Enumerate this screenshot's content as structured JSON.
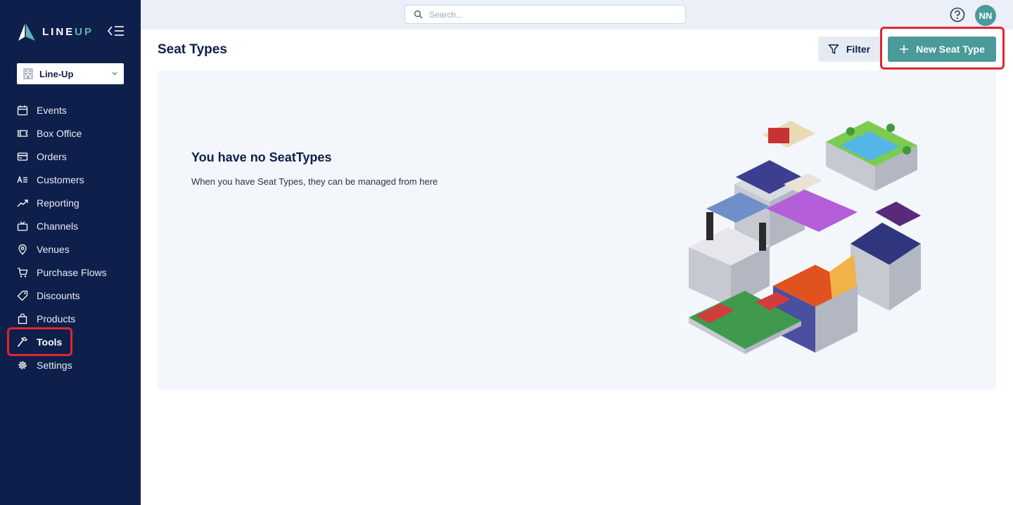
{
  "app": {
    "logo_text_main": "LINE",
    "logo_text_accent": "UP"
  },
  "sidebar": {
    "org_select": {
      "value": "Line-Up"
    },
    "items": [
      {
        "label": "Events",
        "icon": "calendar-icon",
        "active": false
      },
      {
        "label": "Box Office",
        "icon": "ticket-icon",
        "active": false
      },
      {
        "label": "Orders",
        "icon": "credit-card-icon",
        "active": false
      },
      {
        "label": "Customers",
        "icon": "contacts-icon",
        "active": false
      },
      {
        "label": "Reporting",
        "icon": "trend-chart-icon",
        "active": false
      },
      {
        "label": "Channels",
        "icon": "tv-icon",
        "active": false
      },
      {
        "label": "Venues",
        "icon": "map-pin-icon",
        "active": false
      },
      {
        "label": "Purchase Flows",
        "icon": "cart-icon",
        "active": false
      },
      {
        "label": "Discounts",
        "icon": "tags-icon",
        "active": false
      },
      {
        "label": "Products",
        "icon": "shopping-bag-icon",
        "active": false
      },
      {
        "label": "Tools",
        "icon": "hammer-icon",
        "active": true
      },
      {
        "label": "Settings",
        "icon": "gear-icon",
        "active": false
      }
    ]
  },
  "header": {
    "search_placeholder": "Search...",
    "avatar_initials": "NN"
  },
  "main": {
    "title": "Seat Types",
    "filter_label": "Filter",
    "new_button_label": "New Seat Type",
    "empty_title": "You have no SeatTypes",
    "empty_description": "When you have Seat Types, they can be managed from here"
  },
  "colors": {
    "sidebar_bg": "#0f1f4b",
    "accent": "#4a9a9a",
    "highlight": "#e0262f",
    "topbar_bg": "#eaeff8",
    "panel_bg": "#f3f6fb"
  }
}
